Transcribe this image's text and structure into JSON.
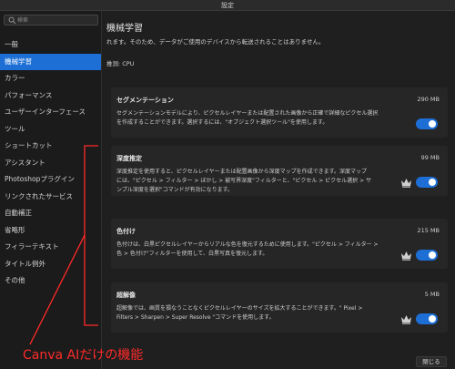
{
  "window": {
    "title": "設定"
  },
  "search": {
    "placeholder": "検索"
  },
  "sidebar": {
    "items": [
      {
        "label": "一般",
        "active": false
      },
      {
        "label": "機械学習",
        "active": true
      },
      {
        "label": "カラー",
        "active": false
      },
      {
        "label": "パフォーマンス",
        "active": false
      },
      {
        "label": "ユーザーインターフェース",
        "active": false
      },
      {
        "label": "ツール",
        "active": false
      },
      {
        "label": "ショートカット",
        "active": false
      },
      {
        "label": "アシスタント",
        "active": false
      },
      {
        "label": "Photoshopプラグイン",
        "active": false
      },
      {
        "label": "リンクされたサービス",
        "active": false
      },
      {
        "label": "自動補正",
        "active": false
      },
      {
        "label": "省略形",
        "active": false
      },
      {
        "label": "フィラーテキスト",
        "active": false
      },
      {
        "label": "タイトル例外",
        "active": false
      },
      {
        "label": "その他",
        "active": false
      }
    ]
  },
  "main": {
    "title": "機械学習",
    "intro": "れます。そのため、データがご使用のデバイスから転送されることはありません。",
    "inference": "推測: CPU",
    "features": [
      {
        "name": "セグメンテーション",
        "size": "290 MB",
        "desc_lines": [
          "セグメンテーションモデルにより、ピクセルレイヤーまたは配置された画像から正確で詳細なピクセル選択",
          "を作成することができます。選択するには、\"オブジェクト選択ツール\"を使用します。"
        ],
        "enabled": true,
        "premium": false
      },
      {
        "name": "深度推定",
        "size": "99 MB",
        "desc_lines": [
          "深度推定を使用すると、ピクセルレイヤーまたは配置画像から深度マップを作成できます。深度マップ",
          "には、\"ピクセル > フィルター > ぼかし > 被写界深度\"フィルターと、\"ピクセル > ピクセル選択 > サ",
          "ンプル深度を選択\"コマンドが有効になります。"
        ],
        "enabled": true,
        "premium": true
      },
      {
        "name": "色付け",
        "size": "215 MB",
        "desc_lines": [
          "色付けは、白黒ピクセルレイヤーからリアルな色を復元するために使用します。\"ピクセル > フィルター >",
          "色 > 色付け\"フィルターを使用して、白黒写真を復元します。"
        ],
        "enabled": true,
        "premium": true
      },
      {
        "name": "超解像",
        "size": "5 MB",
        "desc_lines": [
          "超解像では、画質を損なうことなくピクセルレイヤーのサイズを拡大することができます。\" Pixel >",
          "Filters > Sharpen > Super Resolve \"コマンドを使用します。"
        ],
        "enabled": true,
        "premium": true
      }
    ]
  },
  "footer": {
    "close_label": "閉じる"
  },
  "annotation": {
    "text": "Canva AIだけの機能",
    "color": "#ff2a2a"
  },
  "colors": {
    "accent": "#1d6fd6",
    "background": "#1e1e1e",
    "card": "#262626"
  }
}
